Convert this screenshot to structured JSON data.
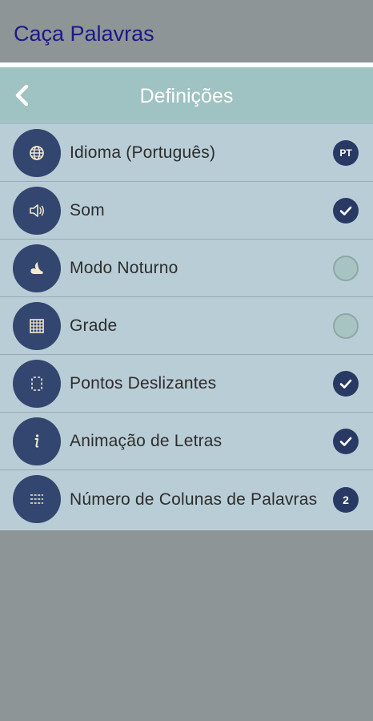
{
  "app": {
    "title": "Caça Palavras"
  },
  "settings": {
    "title": "Definições",
    "back_icon": "chevron-left-icon",
    "items": [
      {
        "key": "language",
        "icon": "globe-icon",
        "label": "Idioma (Português)",
        "control": "badge",
        "value": "PT"
      },
      {
        "key": "sound",
        "icon": "speaker-icon",
        "label": "Som",
        "control": "toggle",
        "checked": true
      },
      {
        "key": "night-mode",
        "icon": "moon-icon",
        "label": "Modo Noturno",
        "control": "toggle",
        "checked": false
      },
      {
        "key": "grid",
        "icon": "grid-icon",
        "label": "Grade",
        "control": "toggle",
        "checked": false
      },
      {
        "key": "sliding-dots",
        "icon": "dotted-frame-icon",
        "label": "Pontos Deslizantes",
        "control": "toggle",
        "checked": true
      },
      {
        "key": "letter-animation",
        "icon": "letter-i-icon",
        "label": "Animação de Letras",
        "control": "toggle",
        "checked": true
      },
      {
        "key": "word-columns",
        "icon": "list-columns-icon",
        "label": "Número de Colunas de Palavras",
        "control": "badge",
        "value": "2"
      }
    ]
  },
  "colors": {
    "app_bar": "#8e9596",
    "app_title": "#1a1a86",
    "header": "#9ec3c2",
    "panel": "#b9cdd6",
    "icon_circle": "#33466f",
    "toggle_on": "#283a63",
    "toggle_off": "#a7c4c3"
  }
}
